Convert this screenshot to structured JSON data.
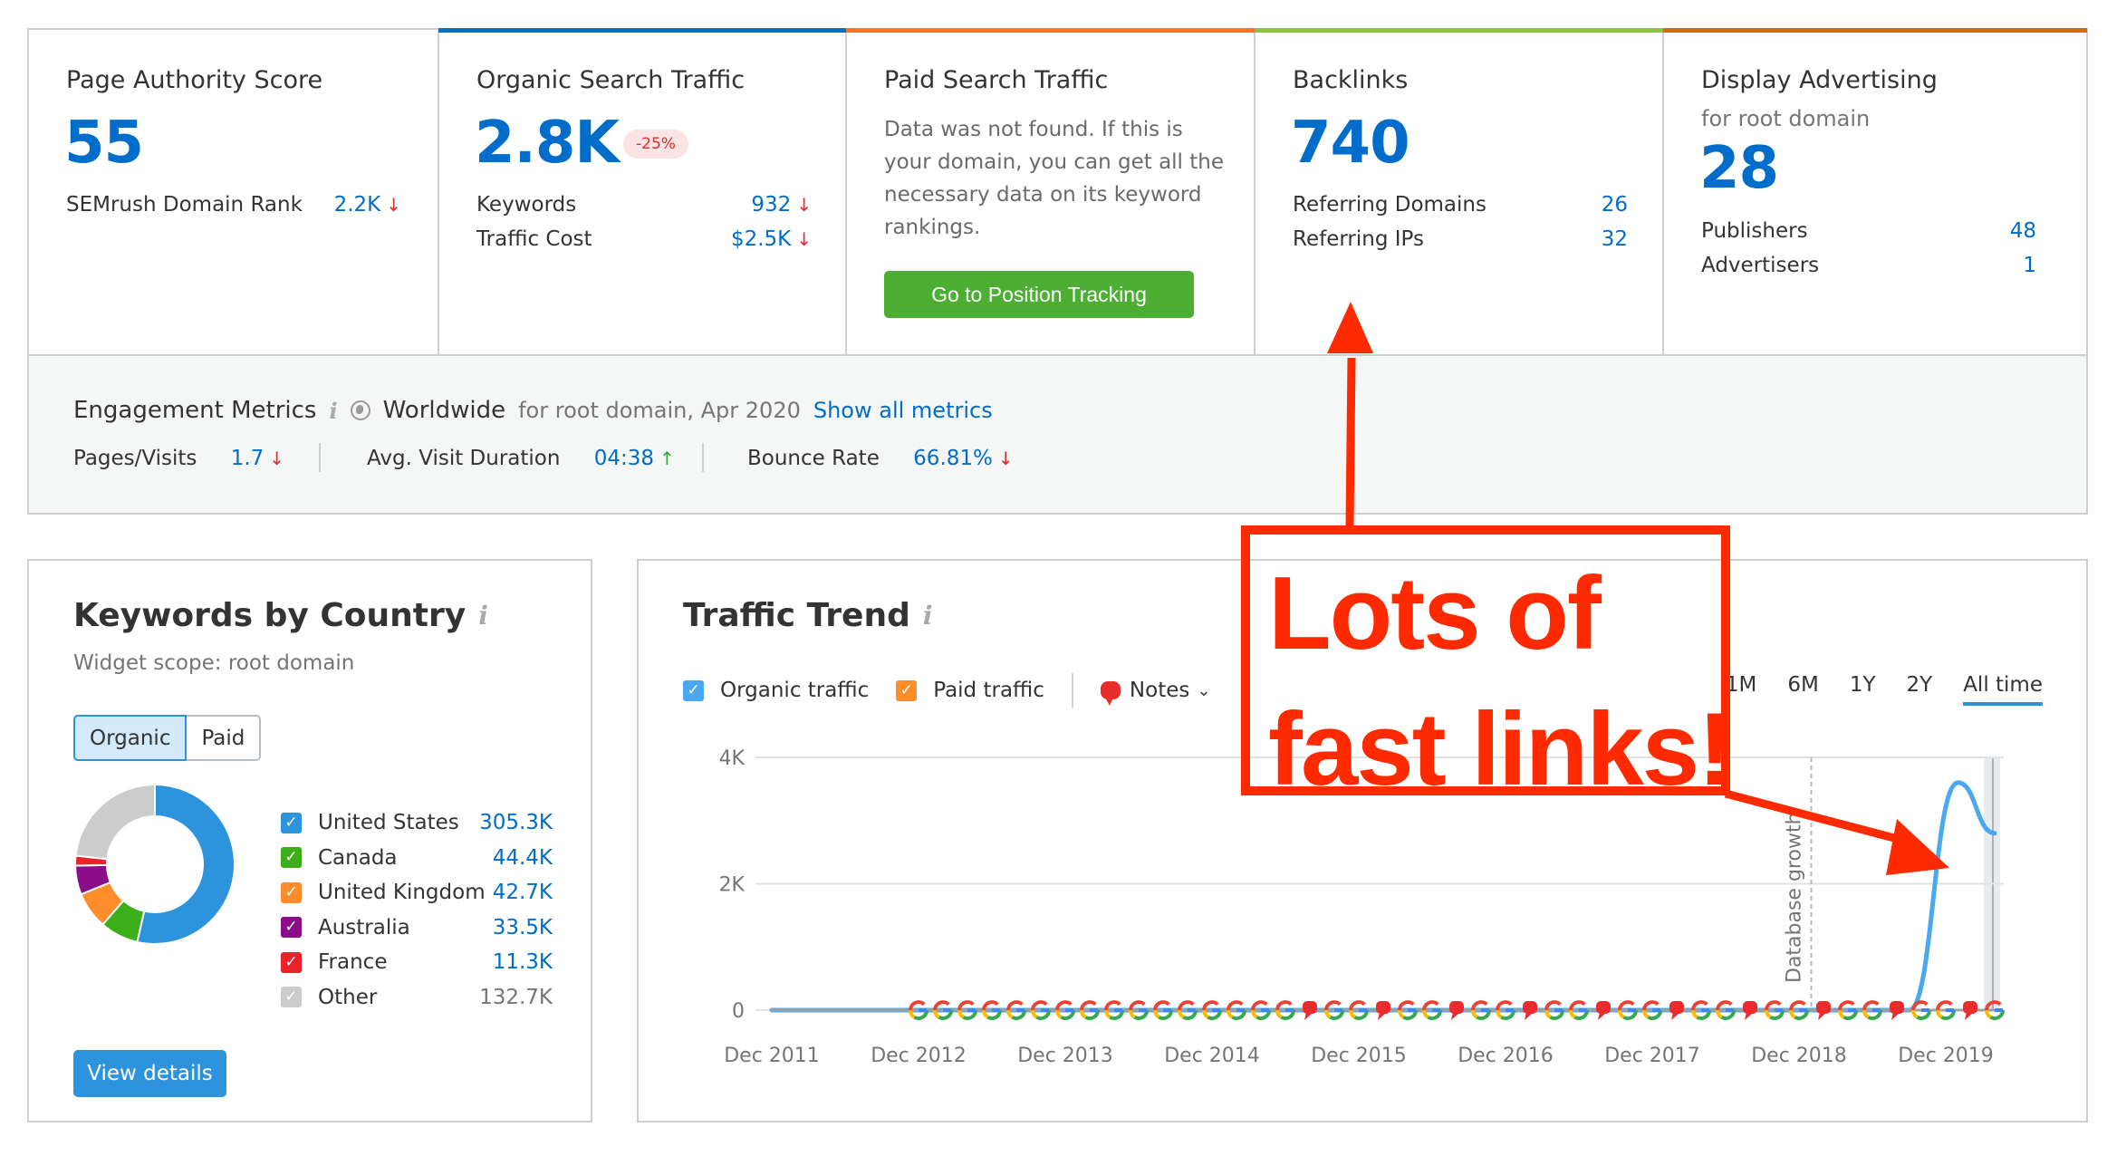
{
  "summary_cards": [
    {
      "title": "Page Authority Score",
      "value": "55",
      "top_color": "",
      "rows": [
        {
          "label": "SEMrush Domain Rank",
          "value": "2.2K",
          "trend": "down"
        }
      ]
    },
    {
      "title": "Organic Search Traffic",
      "value": "2.8K",
      "badge": "-25%",
      "top_color": "#0a6fc2",
      "rows": [
        {
          "label": "Keywords",
          "value": "932",
          "trend": "down"
        },
        {
          "label": "Traffic Cost",
          "value": "$2.5K",
          "trend": "down"
        }
      ]
    },
    {
      "title": "Paid Search Traffic",
      "description": "Data was not found. If this is your domain, you can get all the necessary data on its keyword rankings.",
      "button": "Go to Position Tracking",
      "top_color": "#ff7420"
    },
    {
      "title": "Backlinks",
      "value": "740",
      "top_color": "#8cc63e",
      "rows": [
        {
          "label": "Referring Domains",
          "value": "26"
        },
        {
          "label": "Referring IPs",
          "value": "32"
        }
      ]
    },
    {
      "title": "Display Advertising",
      "subtitle": "for root domain",
      "value": "28",
      "top_color": "#c8710b",
      "rows": [
        {
          "label": "Publishers",
          "value": "48"
        },
        {
          "label": "Advertisers",
          "value": "1"
        }
      ]
    }
  ],
  "trend_glyphs": {
    "down": "↓",
    "up": "↑"
  },
  "engagement": {
    "title": "Engagement Metrics",
    "info_glyph": "i",
    "region": "Worldwide",
    "scope": "for root domain, Apr 2020",
    "link": "Show all metrics",
    "metrics": [
      {
        "label": "Pages/Visits",
        "value": "1.7",
        "trend": "down"
      },
      {
        "label": "Avg. Visit Duration",
        "value": "04:38",
        "trend": "up"
      },
      {
        "label": "Bounce Rate",
        "value": "66.81%",
        "trend": "down"
      }
    ]
  },
  "keywords_by_country": {
    "title": "Keywords by Country",
    "info_glyph": "i",
    "scope": "Widget scope: root domain",
    "toggle": [
      "Organic",
      "Paid"
    ],
    "toggle_active": "Organic",
    "check_glyph": "✓",
    "button": "View details",
    "chart_data": {
      "type": "pie",
      "donut": true,
      "categories": [
        "United States",
        "Canada",
        "United Kingdom",
        "Australia",
        "France",
        "Other"
      ],
      "values": [
        305.3,
        44.4,
        42.7,
        33.5,
        11.3,
        132.7
      ],
      "labels": [
        "305.3K",
        "44.4K",
        "42.7K",
        "33.5K",
        "11.3K",
        "132.7K"
      ],
      "colors": [
        "#2e93dd",
        "#3bae1a",
        "#ff8d2b",
        "#8a0e8a",
        "#ea2229",
        "#cccccc"
      ],
      "unit": "K"
    }
  },
  "traffic_trend": {
    "title": "Traffic Trend",
    "info_glyph": "i",
    "series_toggles": [
      {
        "label": "Organic traffic",
        "color": "#4aa8f0",
        "checked": true
      },
      {
        "label": "Paid traffic",
        "color": "#ff8d2b",
        "checked": true
      }
    ],
    "notes_label": "Notes",
    "notes_chevron": "⌄",
    "ranges": [
      "1M",
      "6M",
      "1Y",
      "2Y",
      "All time"
    ],
    "range_active": "All time",
    "chart_data": {
      "type": "line",
      "x_ticks": [
        "Dec 2011",
        "Dec 2012",
        "Dec 2013",
        "Dec 2014",
        "Dec 2015",
        "Dec 2016",
        "Dec 2017",
        "Dec 2018",
        "Dec 2019"
      ],
      "y_ticks": [
        "0",
        "2K",
        "4K"
      ],
      "ylim": [
        0,
        4000
      ],
      "xlim": [
        "Dec 2011",
        "Apr 2020"
      ],
      "grid": true,
      "annotation_line": {
        "label": "Database growth",
        "x": "Jan 2019"
      },
      "series": [
        {
          "name": "Organic traffic",
          "color": "#4aa8f0",
          "points": [
            [
              "Dec 2011",
              0
            ],
            [
              "Dec 2012",
              0
            ],
            [
              "Dec 2013",
              0
            ],
            [
              "Dec 2014",
              0
            ],
            [
              "Dec 2015",
              0
            ],
            [
              "Dec 2016",
              0
            ],
            [
              "Dec 2017",
              0
            ],
            [
              "Dec 2018",
              0
            ],
            [
              "Sep 2019",
              0
            ],
            [
              "Jan 2020",
              3600
            ],
            [
              "Apr 2020",
              2800
            ]
          ]
        },
        {
          "name": "Paid traffic",
          "color": "#ff8d2b",
          "points": [
            [
              "Dec 2011",
              0
            ],
            [
              "Apr 2020",
              0
            ]
          ]
        }
      ],
      "markers": "Google algorithm update (G) and note markers along the baseline from Dec 2012 to Apr 2020"
    }
  },
  "annotation": {
    "text_line1": "Lots of",
    "text_line2": "fast links!",
    "color": "#ff2a00"
  }
}
